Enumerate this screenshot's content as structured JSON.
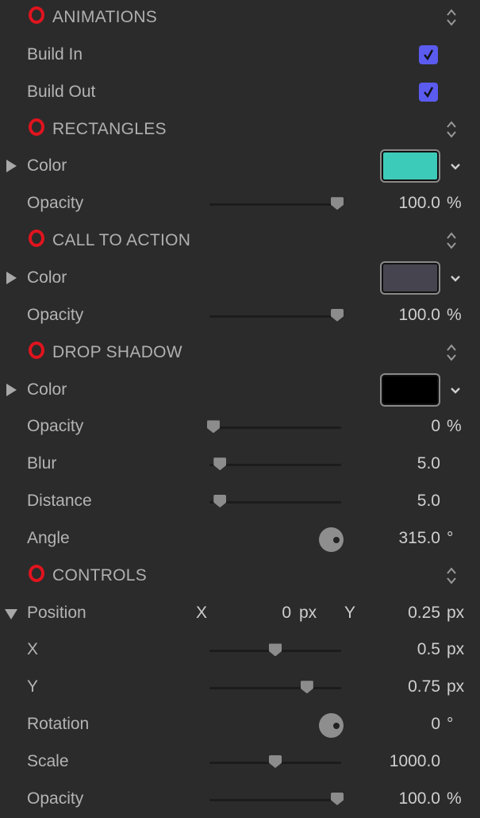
{
  "accent_color": "#5b5bf0",
  "header_icon": "red-circle-icon",
  "rows": [
    {
      "type": "header",
      "label": "ANIMATIONS"
    },
    {
      "type": "check",
      "label": "Build In",
      "checked": true
    },
    {
      "type": "check",
      "label": "Build Out",
      "checked": true
    },
    {
      "type": "header",
      "label": "RECTANGLES"
    },
    {
      "type": "color",
      "label": "Color",
      "color": "#3dcbb9"
    },
    {
      "type": "slider",
      "label": "Opacity",
      "value": "100.0",
      "unit": "%",
      "fraction": 0.97
    },
    {
      "type": "header",
      "label": "CALL TO ACTION"
    },
    {
      "type": "color",
      "label": "Color",
      "color": "#46454f"
    },
    {
      "type": "slider",
      "label": "Opacity",
      "value": "100.0",
      "unit": "%",
      "fraction": 0.97
    },
    {
      "type": "header",
      "label": "DROP SHADOW"
    },
    {
      "type": "color",
      "label": "Color",
      "color": "#000000"
    },
    {
      "type": "slider",
      "label": "Opacity",
      "value": "0",
      "unit": "%",
      "fraction": 0.03
    },
    {
      "type": "slider",
      "label": "Blur",
      "value": "5.0",
      "unit": "",
      "fraction": 0.08
    },
    {
      "type": "slider",
      "label": "Distance",
      "value": "5.0",
      "unit": "",
      "fraction": 0.08
    },
    {
      "type": "dial",
      "label": "Angle",
      "value": "315.0",
      "unit": "°"
    },
    {
      "type": "header",
      "label": "CONTROLS"
    },
    {
      "type": "position",
      "label": "Position",
      "x_label": "X",
      "x_value": "0",
      "x_unit": "px",
      "y_label": "Y",
      "y_value": "0.25",
      "y_unit": "px"
    },
    {
      "type": "slider",
      "label": "X",
      "value": "0.5",
      "unit": "px",
      "fraction": 0.5
    },
    {
      "type": "slider",
      "label": "Y",
      "value": "0.75",
      "unit": "px",
      "fraction": 0.74
    },
    {
      "type": "dial",
      "label": "Rotation",
      "value": "0",
      "unit": "°"
    },
    {
      "type": "slider",
      "label": "Scale",
      "value": "1000.0",
      "unit": "",
      "fraction": 0.5
    },
    {
      "type": "slider",
      "label": "Opacity",
      "value": "100.0",
      "unit": "%",
      "fraction": 0.97
    }
  ]
}
